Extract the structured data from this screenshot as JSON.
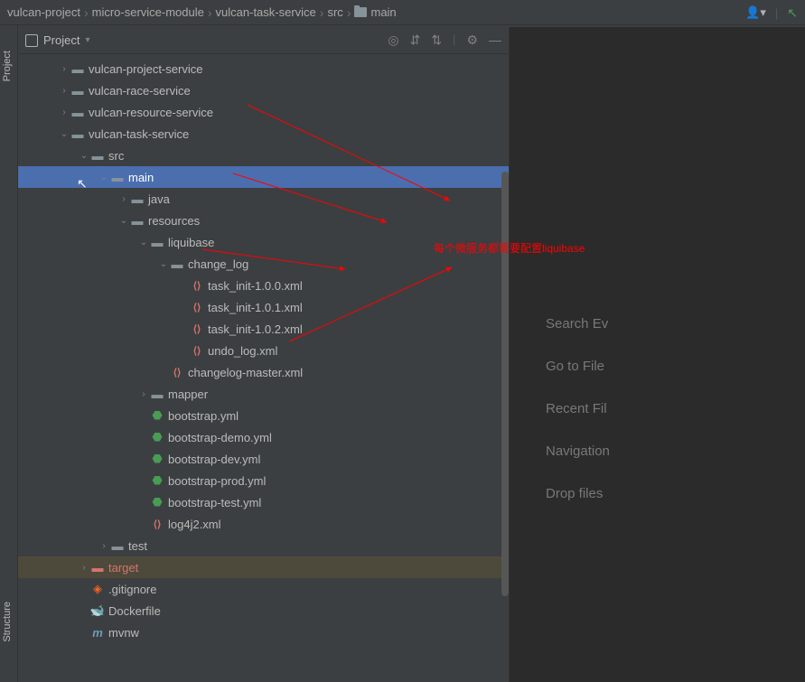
{
  "breadcrumb": [
    "vulcan-project",
    "micro-service-module",
    "vulcan-task-service",
    "src",
    "main"
  ],
  "panel": {
    "title": "Project"
  },
  "tree": {
    "items": [
      {
        "depth": 2,
        "arrow": "collapsed",
        "icon": "module",
        "label": "vulcan-project-service"
      },
      {
        "depth": 2,
        "arrow": "collapsed",
        "icon": "module",
        "label": "vulcan-race-service"
      },
      {
        "depth": 2,
        "arrow": "collapsed",
        "icon": "module",
        "label": "vulcan-resource-service"
      },
      {
        "depth": 2,
        "arrow": "expanded",
        "icon": "module",
        "label": "vulcan-task-service"
      },
      {
        "depth": 3,
        "arrow": "expanded",
        "icon": "folder",
        "label": "src"
      },
      {
        "depth": 4,
        "arrow": "expanded",
        "icon": "folder",
        "label": "main",
        "selected": true
      },
      {
        "depth": 5,
        "arrow": "collapsed",
        "icon": "folder",
        "label": "java"
      },
      {
        "depth": 5,
        "arrow": "expanded",
        "icon": "resources",
        "label": "resources"
      },
      {
        "depth": 6,
        "arrow": "expanded",
        "icon": "folder",
        "label": "liquibase"
      },
      {
        "depth": 7,
        "arrow": "expanded",
        "icon": "folder",
        "label": "change_log"
      },
      {
        "depth": 8,
        "arrow": "none",
        "icon": "xml",
        "label": "task_init-1.0.0.xml"
      },
      {
        "depth": 8,
        "arrow": "none",
        "icon": "xml",
        "label": "task_init-1.0.1.xml"
      },
      {
        "depth": 8,
        "arrow": "none",
        "icon": "xml",
        "label": "task_init-1.0.2.xml"
      },
      {
        "depth": 8,
        "arrow": "none",
        "icon": "xml",
        "label": "undo_log.xml"
      },
      {
        "depth": 7,
        "arrow": "none",
        "icon": "xml",
        "label": "changelog-master.xml"
      },
      {
        "depth": 6,
        "arrow": "collapsed",
        "icon": "folder",
        "label": "mapper"
      },
      {
        "depth": 6,
        "arrow": "none",
        "icon": "yml",
        "label": "bootstrap.yml"
      },
      {
        "depth": 6,
        "arrow": "none",
        "icon": "yml",
        "label": "bootstrap-demo.yml"
      },
      {
        "depth": 6,
        "arrow": "none",
        "icon": "yml",
        "label": "bootstrap-dev.yml"
      },
      {
        "depth": 6,
        "arrow": "none",
        "icon": "yml",
        "label": "bootstrap-prod.yml"
      },
      {
        "depth": 6,
        "arrow": "none",
        "icon": "yml",
        "label": "bootstrap-test.yml"
      },
      {
        "depth": 6,
        "arrow": "none",
        "icon": "xml",
        "label": "log4j2.xml"
      },
      {
        "depth": 4,
        "arrow": "collapsed",
        "icon": "folder",
        "label": "test"
      },
      {
        "depth": 3,
        "arrow": "collapsed",
        "icon": "target",
        "label": "target",
        "target": true
      },
      {
        "depth": 3,
        "arrow": "none",
        "icon": "git",
        "label": ".gitignore"
      },
      {
        "depth": 3,
        "arrow": "none",
        "icon": "docker",
        "label": "Dockerfile"
      },
      {
        "depth": 3,
        "arrow": "none",
        "icon": "m",
        "label": "mvnw"
      }
    ]
  },
  "editor": {
    "hints": [
      "Search Ev",
      "Go to File",
      "Recent Fil",
      "Navigation",
      "Drop files"
    ]
  },
  "annotation": "每个微服务都需要配置liquibase",
  "gutters": {
    "project": "Project",
    "structure": "Structure"
  }
}
